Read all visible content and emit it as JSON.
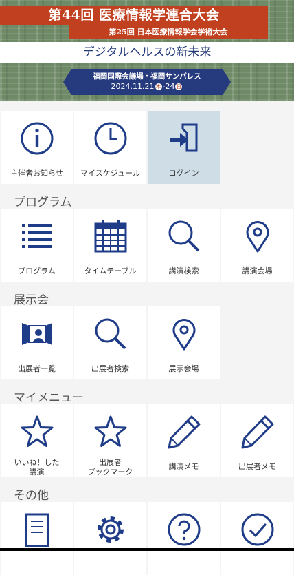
{
  "banner": {
    "title": "第44回 医療情報学連合大会",
    "subtitle2": "第25回 日本医療情報学会学術大会",
    "theme": "デジタルヘルスの新未来",
    "venue": "福岡国際会議場・福岡サンパレス",
    "date_prefix": "2024.11.21",
    "day1": "木",
    "date_mid": "-24",
    "day2": "日"
  },
  "top_menu": [
    {
      "label": "主催者お知らせ",
      "icon": "info-icon"
    },
    {
      "label": "マイスケジュール",
      "icon": "clock-icon"
    },
    {
      "label": "ログイン",
      "icon": "login-icon",
      "selected": true
    }
  ],
  "sections": {
    "program": {
      "title": "プログラム",
      "items": [
        {
          "label": "プログラム",
          "icon": "list-icon"
        },
        {
          "label": "タイムテーブル",
          "icon": "calendar-icon"
        },
        {
          "label": "講演検索",
          "icon": "search-icon"
        },
        {
          "label": "講演会場",
          "icon": "map-pin-icon"
        }
      ]
    },
    "exhibit": {
      "title": "展示会",
      "items": [
        {
          "label": "出展者一覧",
          "icon": "exhibitor-icon"
        },
        {
          "label": "出展者検索",
          "icon": "search-icon"
        },
        {
          "label": "展示会場",
          "icon": "map-pin-icon"
        }
      ]
    },
    "mymenu": {
      "title": "マイメニュー",
      "items": [
        {
          "line1": "いいね！した",
          "line2": "講演",
          "icon": "star-icon"
        },
        {
          "line1": "出展者",
          "line2": "ブックマーク",
          "icon": "star-icon"
        },
        {
          "label": "講演メモ",
          "icon": "pencil-icon"
        },
        {
          "label": "出展者メモ",
          "icon": "pencil-icon"
        }
      ]
    },
    "other": {
      "title": "その他",
      "items": [
        {
          "icon": "document-icon"
        },
        {
          "icon": "gear-icon"
        },
        {
          "icon": "help-icon"
        },
        {
          "icon": "check-circle-icon"
        }
      ]
    }
  },
  "colors": {
    "accent": "#1f3c88",
    "banner_red": "#c1401f",
    "selected": "#cfdde7"
  }
}
